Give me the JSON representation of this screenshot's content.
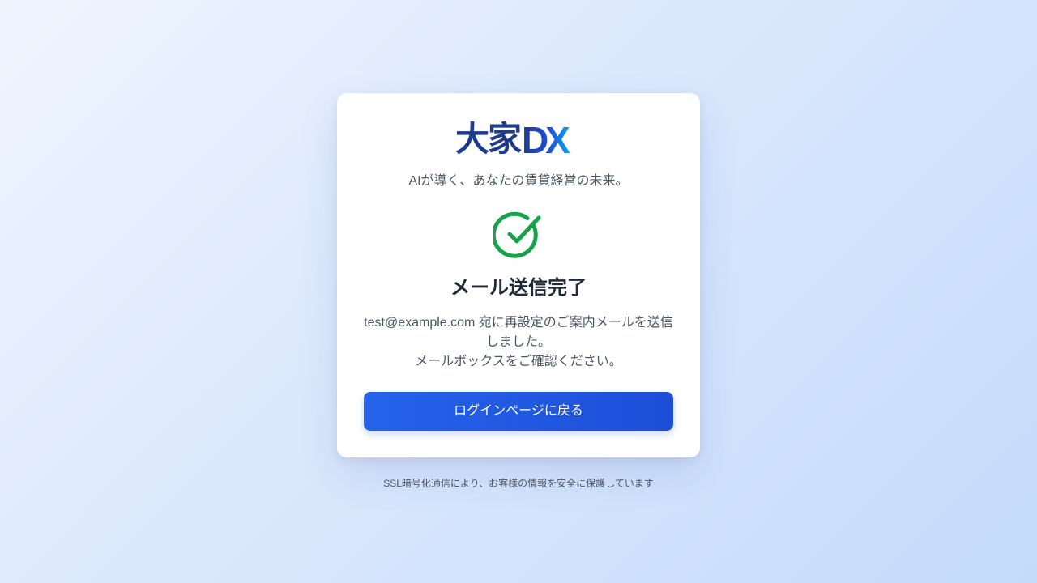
{
  "brand": {
    "logo_kanji": "大家",
    "logo_latin": "DX",
    "tagline": "AIが導く、あなたの賃貸経営の未来。"
  },
  "status": {
    "icon": "check-circle-icon",
    "color": "#16a34a",
    "title": "メール送信完了",
    "message_line1": "test@example.com 宛に再設定のご案内メールを送信しました。",
    "message_line2": "メールボックスをご確認ください。"
  },
  "actions": {
    "back_to_login_label": "ログインページに戻る",
    "primary_color": "#2563eb"
  },
  "footer": {
    "security_note": "SSL暗号化通信により、お客様の情報を安全に保護しています"
  }
}
